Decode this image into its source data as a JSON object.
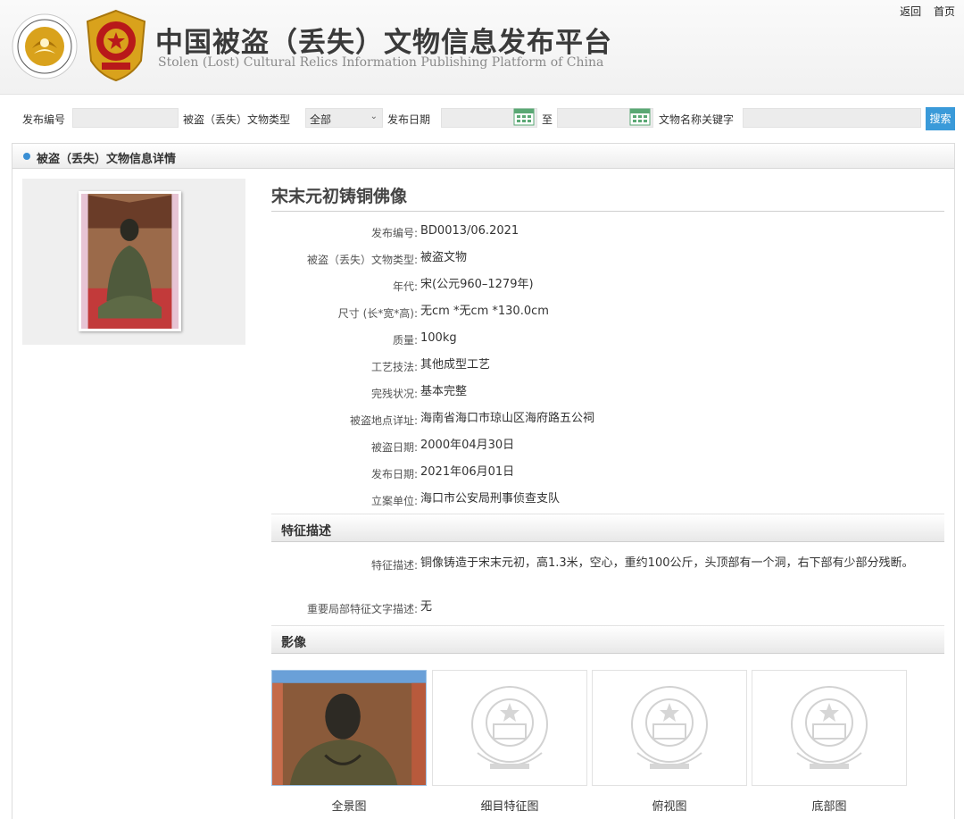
{
  "header": {
    "site_title": "中国被盗（丢失）文物信息发布平台",
    "site_subtitle": "Stolen (Lost) Cultural Relics Information Publishing Platform of China",
    "link_back": "返回",
    "link_home": "首页"
  },
  "search": {
    "label_id": "发布编号",
    "label_type": "被盗（丢失）文物类型",
    "type_value": "全部",
    "label_date": "发布日期",
    "label_to": "至",
    "label_keyword": "文物名称关键字",
    "button": "搜索"
  },
  "panel": {
    "title": "被盗（丢失）文物信息详情"
  },
  "relic": {
    "name": "宋末元初铸铜佛像",
    "fields": [
      {
        "label": "发布编号:",
        "value": "BD0013/06.2021"
      },
      {
        "label": "被盗（丢失）文物类型:",
        "value": "被盗文物"
      },
      {
        "label": "年代:",
        "value": "宋(公元960–1279年)"
      },
      {
        "label": "尺寸 (长*宽*高):",
        "value": "无cm *无cm *130.0cm"
      },
      {
        "label": "质量:",
        "value": "100kg"
      },
      {
        "label": "工艺技法:",
        "value": "其他成型工艺"
      },
      {
        "label": "完残状况:",
        "value": "基本完整"
      },
      {
        "label": "被盗地点详址:",
        "value": "海南省海口市琼山区海府路五公祠"
      },
      {
        "label": "被盗日期:",
        "value": "2000年04月30日"
      },
      {
        "label": "发布日期:",
        "value": "2021年06月01日"
      },
      {
        "label": "立案单位:",
        "value": "海口市公安局刑事侦查支队"
      }
    ]
  },
  "features": {
    "section_title": "特征描述",
    "desc_label": "特征描述:",
    "desc_value": "铜像铸造于宋末元初，高1.3米，空心，重约100公斤，头顶部有一个洞，右下部有少部分残断。",
    "local_label": "重要局部特征文字描述:",
    "local_value": "无"
  },
  "images": {
    "section_title": "影像",
    "captions": [
      "全景图",
      "细目特征图",
      "俯视图",
      "底部图"
    ]
  }
}
